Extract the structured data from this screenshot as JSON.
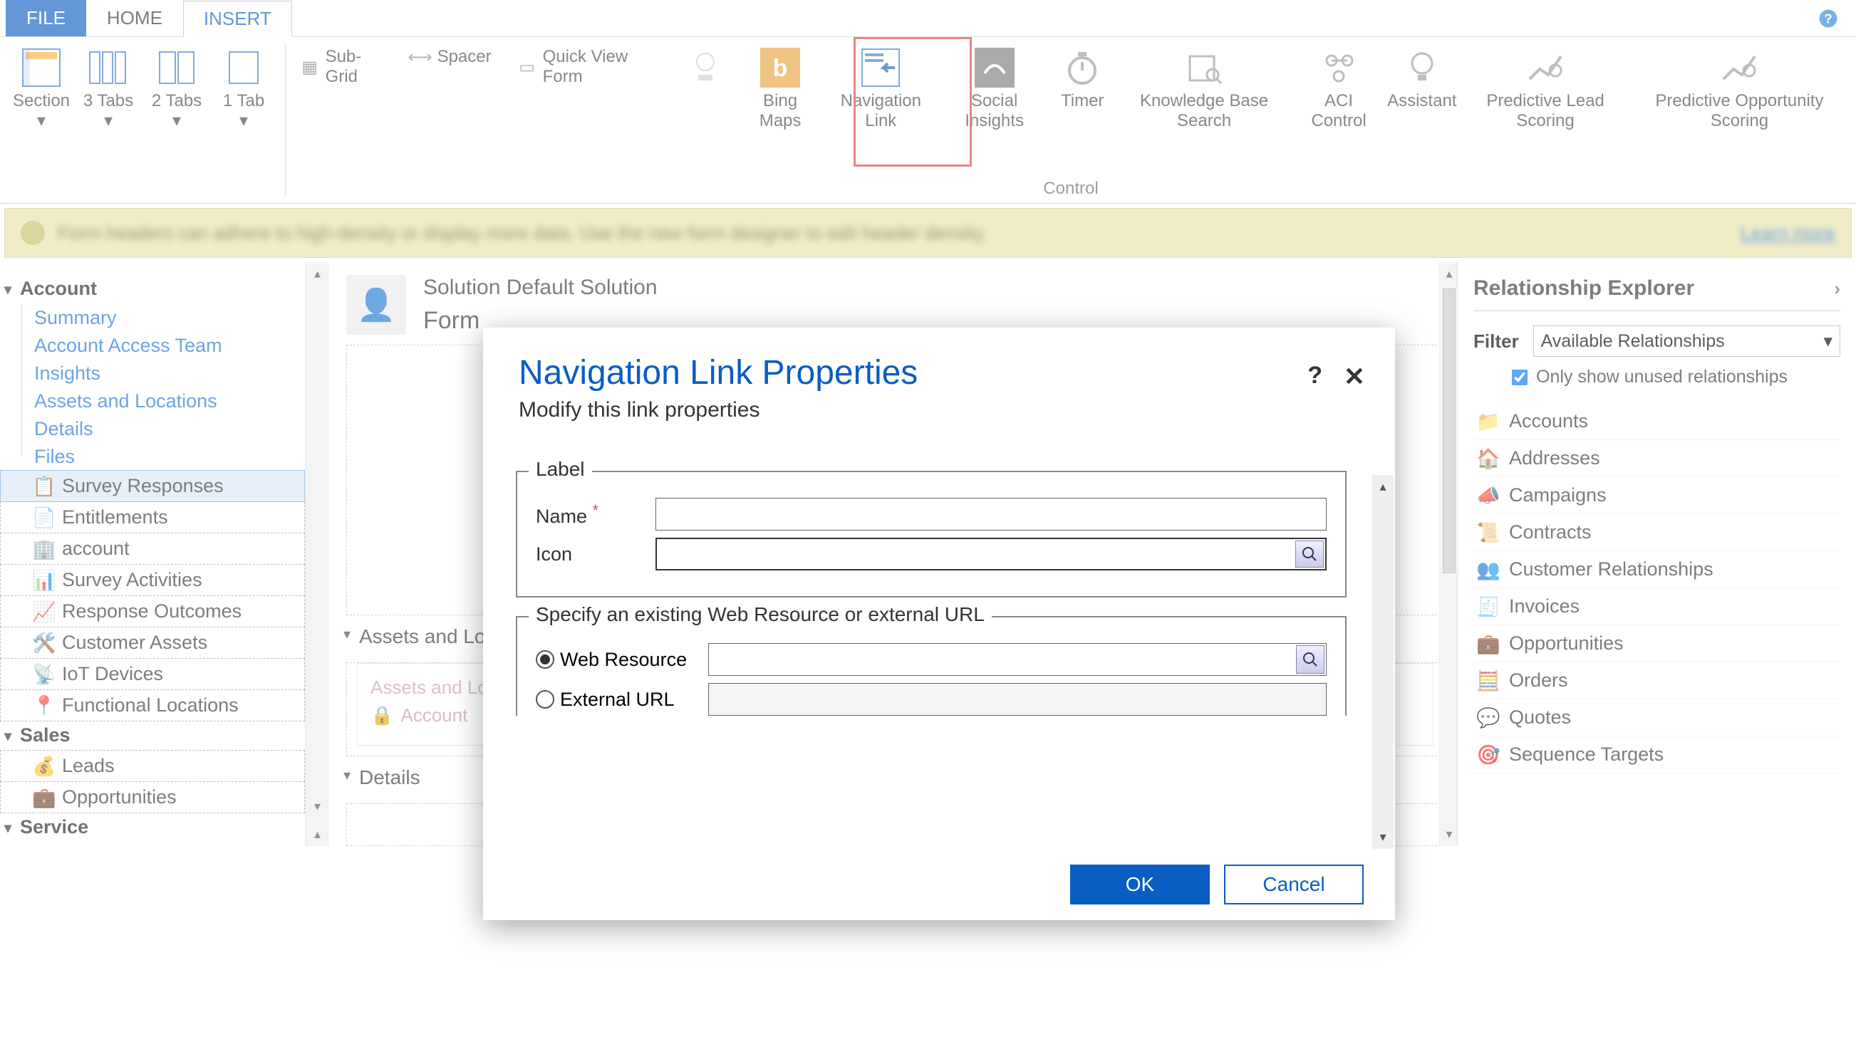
{
  "tabs": {
    "file": "FILE",
    "home": "HOME",
    "insert": "INSERT"
  },
  "ribbon": {
    "section": "Section",
    "tabs3": "3 Tabs",
    "tabs2": "2 Tabs",
    "tab1": "1 Tab",
    "subgrid": "Sub-Grid",
    "spacer": "Spacer",
    "quickview": "Quick View Form",
    "bingmaps": "Bing Maps",
    "navlink": "Navigation Link",
    "social": "Social Insights",
    "timer": "Timer",
    "kbsearch": "Knowledge Base Search",
    "aci": "ACI Control",
    "assistant": "Assistant",
    "predlead": "Predictive Lead Scoring",
    "predopp": "Predictive Opportunity Scoring",
    "group_control": "Control"
  },
  "notice": {
    "text": "Form headers can adhere to high-density or display more data. Use the new form designer to edit header density.",
    "link": "Learn more"
  },
  "nav": {
    "group1": "Account",
    "links": [
      "Summary",
      "Account Access Team",
      "Insights",
      "Assets and Locations",
      "Details",
      "Files"
    ],
    "rows": [
      "Survey Responses",
      "Entitlements",
      "account",
      "Survey Activities",
      "Response Outcomes",
      "Customer Assets",
      "IoT Devices",
      "Functional Locations"
    ],
    "group2": "Sales",
    "sales": [
      "Leads",
      "Opportunities"
    ],
    "group3": "Service"
  },
  "entity": {
    "l1": "Solution Default Solution",
    "l2": "Form"
  },
  "sections": {
    "assets": "Assets and Locations",
    "assets_inner": "Assets and Locations",
    "account_field": "Account",
    "details": "Details"
  },
  "rel": {
    "title": "Relationship Explorer",
    "filter_label": "Filter",
    "filter_value": "Available Relationships",
    "checkbox": "Only show unused relationships",
    "items": [
      "Accounts",
      "Addresses",
      "Campaigns",
      "Contracts",
      "Customer Relationships",
      "Invoices",
      "Opportunities",
      "Orders",
      "Quotes",
      "Sequence Targets"
    ]
  },
  "modal": {
    "title": "Navigation Link Properties",
    "subtitle": "Modify this link properties",
    "legend_label": "Label",
    "name": "Name",
    "icon": "Icon",
    "legend_url": "Specify an existing Web Resource or external URL",
    "webresource": "Web Resource",
    "external": "External URL",
    "ok": "OK",
    "cancel": "Cancel"
  }
}
